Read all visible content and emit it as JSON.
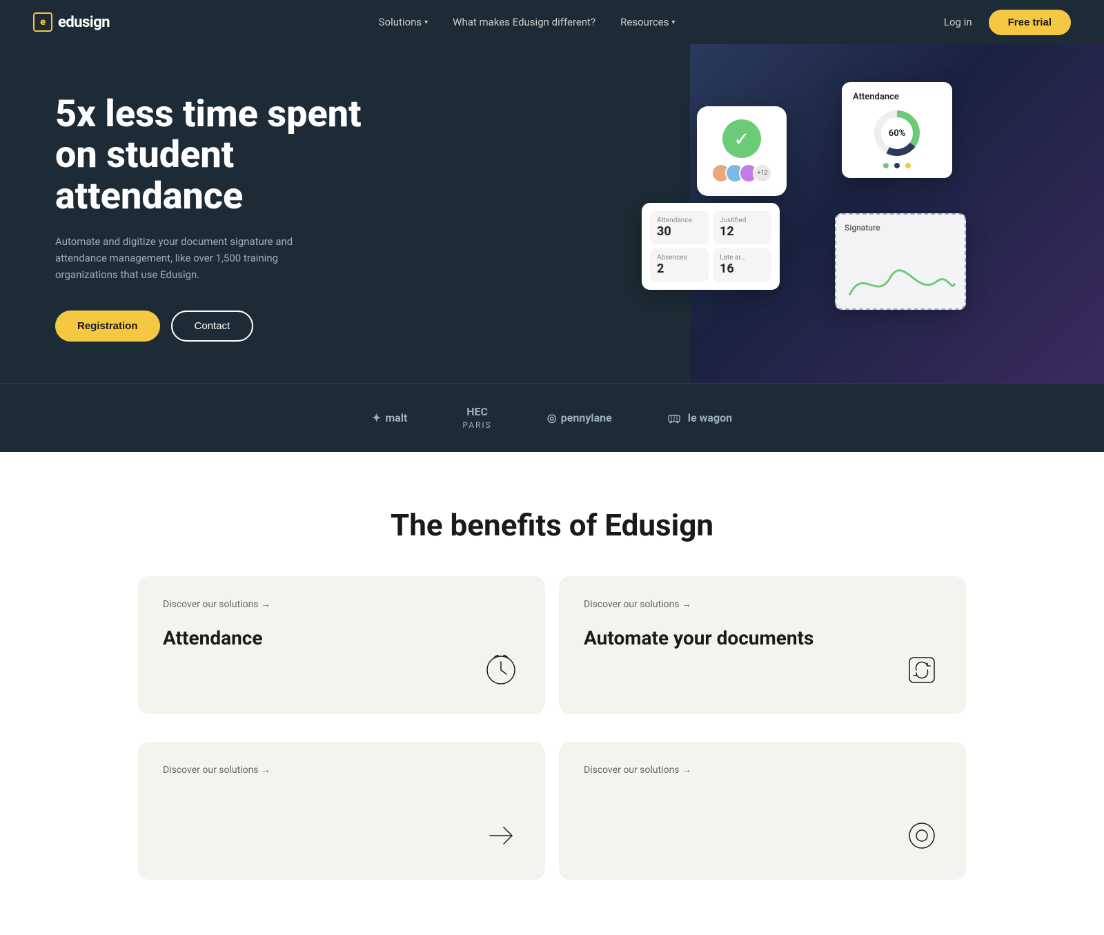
{
  "nav": {
    "logo": "edusign",
    "logo_e": "e",
    "links": [
      {
        "label": "Solutions",
        "has_dropdown": true
      },
      {
        "label": "What makes Edusign different?",
        "has_dropdown": false
      },
      {
        "label": "Resources",
        "has_dropdown": true
      }
    ],
    "login_label": "Log in",
    "free_trial_label": "Free trial"
  },
  "hero": {
    "title": "5x less time spent on student attendance",
    "description": "Automate and digitize your document signature and attendance management, like over 1,500 training organizations that use Edusign.",
    "btn_registration": "Registration",
    "btn_contact": "Contact",
    "attendance_card": {
      "title": "Attendance",
      "percent": "60%",
      "legend": [
        "#6bcb77",
        "#2a3a5c",
        "#f5c842"
      ]
    },
    "stats": [
      {
        "label": "Attendance",
        "value": "30"
      },
      {
        "label": "Justified",
        "value": "12"
      },
      {
        "label": "Absences",
        "value": "2"
      },
      {
        "label": "Late ar...",
        "value": "16"
      }
    ],
    "signature_label": "Signature",
    "avatar_count": "+12"
  },
  "partners": [
    {
      "label": "malt",
      "prefix": "✦"
    },
    {
      "label": "HEC\nPARIS",
      "prefix": ""
    },
    {
      "label": "pennylane",
      "prefix": "◎"
    },
    {
      "label": "le wagon",
      "prefix": "🚃"
    }
  ],
  "benefits": {
    "title": "The benefits of Edusign",
    "cards": [
      {
        "discover": "Discover our solutions →",
        "title": "Attendance",
        "icon": "clock"
      },
      {
        "discover": "Discover our solutions →",
        "title": "Automate your documents",
        "icon": "refresh-square"
      },
      {
        "discover": "Discover our solutions →",
        "title": "",
        "icon": "arrow-right"
      },
      {
        "discover": "Discover our solutions →",
        "title": "",
        "icon": "circle"
      }
    ]
  }
}
